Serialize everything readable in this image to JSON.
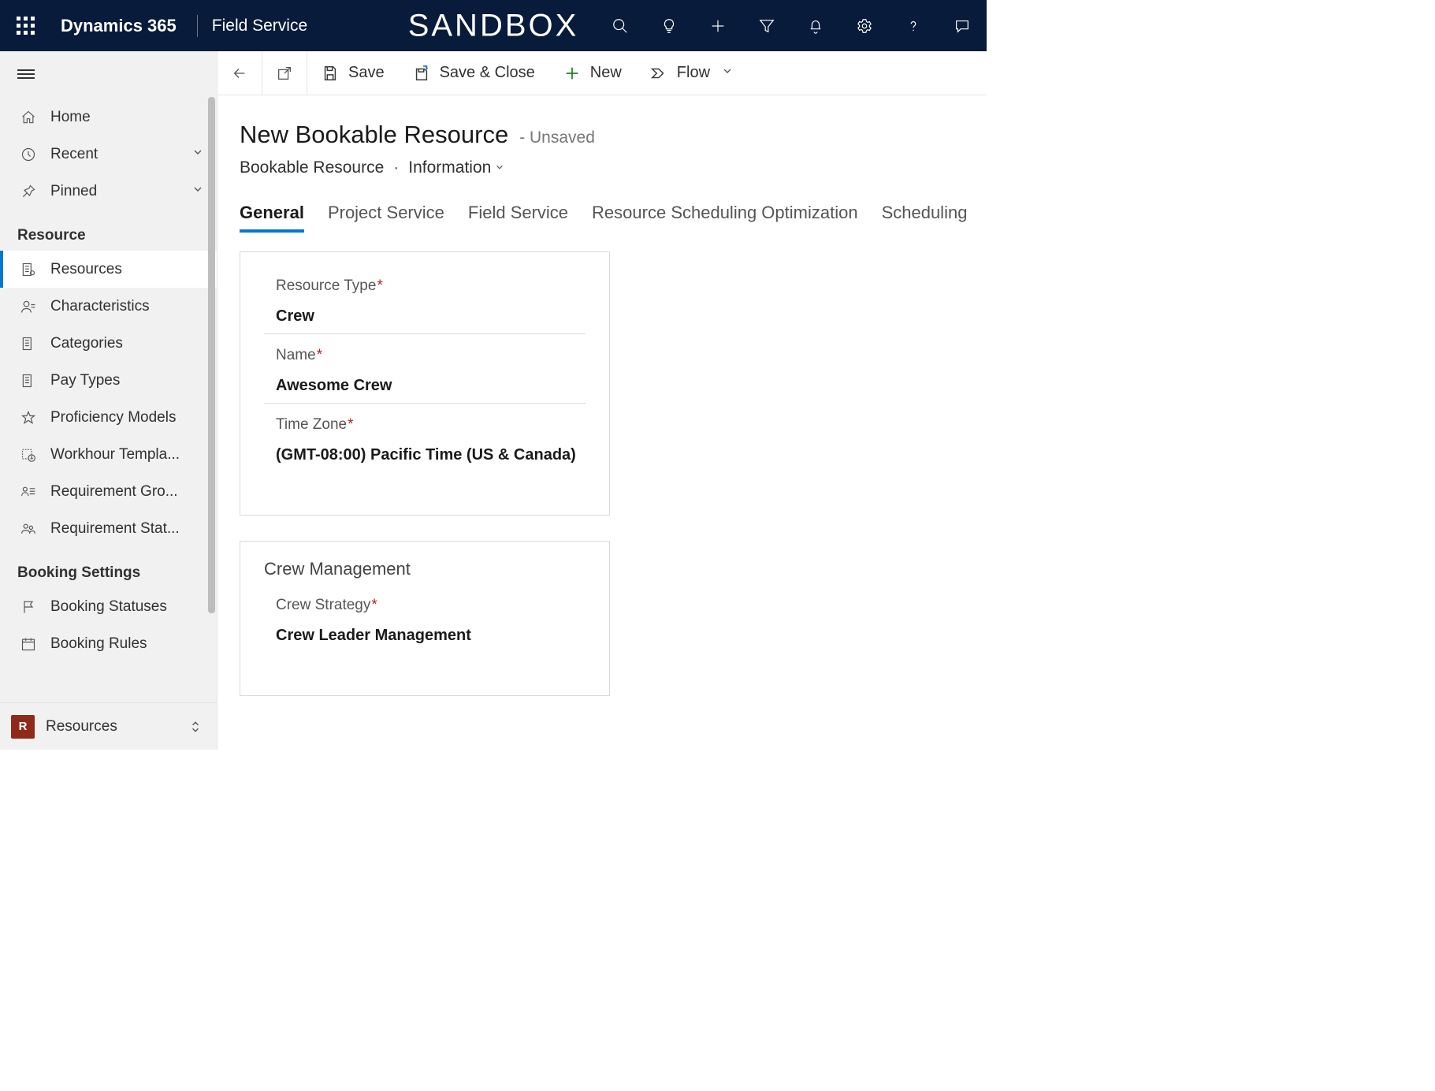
{
  "topbar": {
    "brand": "Dynamics 365",
    "module": "Field Service",
    "env": "SANDBOX"
  },
  "cmdbar": {
    "save": "Save",
    "save_close": "Save & Close",
    "new": "New",
    "flow": "Flow"
  },
  "page": {
    "title": "New Bookable Resource",
    "unsaved": "- Unsaved",
    "entity": "Bookable Resource",
    "formname": "Information"
  },
  "tabs": [
    "General",
    "Project Service",
    "Field Service",
    "Resource Scheduling Optimization",
    "Scheduling"
  ],
  "tab_active_index": 0,
  "nav": {
    "home": "Home",
    "recent": "Recent",
    "pinned": "Pinned",
    "section_resource": "Resource",
    "items_resource": [
      "Resources",
      "Characteristics",
      "Categories",
      "Pay Types",
      "Proficiency Models",
      "Workhour Templa...",
      "Requirement Gro...",
      "Requirement Stat..."
    ],
    "section_booking": "Booking Settings",
    "items_booking": [
      "Booking Statuses",
      "Booking Rules"
    ]
  },
  "footer": {
    "chip": "R",
    "label": "Resources"
  },
  "form": {
    "fields": [
      {
        "label": "Resource Type",
        "required": true,
        "value": "Crew"
      },
      {
        "label": "Name",
        "required": true,
        "value": "Awesome Crew"
      },
      {
        "label": "Time Zone",
        "required": true,
        "value": "(GMT-08:00) Pacific Time (US & Canada)"
      }
    ],
    "crew_section_title": "Crew Management",
    "crew_field": {
      "label": "Crew Strategy",
      "required": true,
      "value": "Crew Leader Management"
    }
  }
}
